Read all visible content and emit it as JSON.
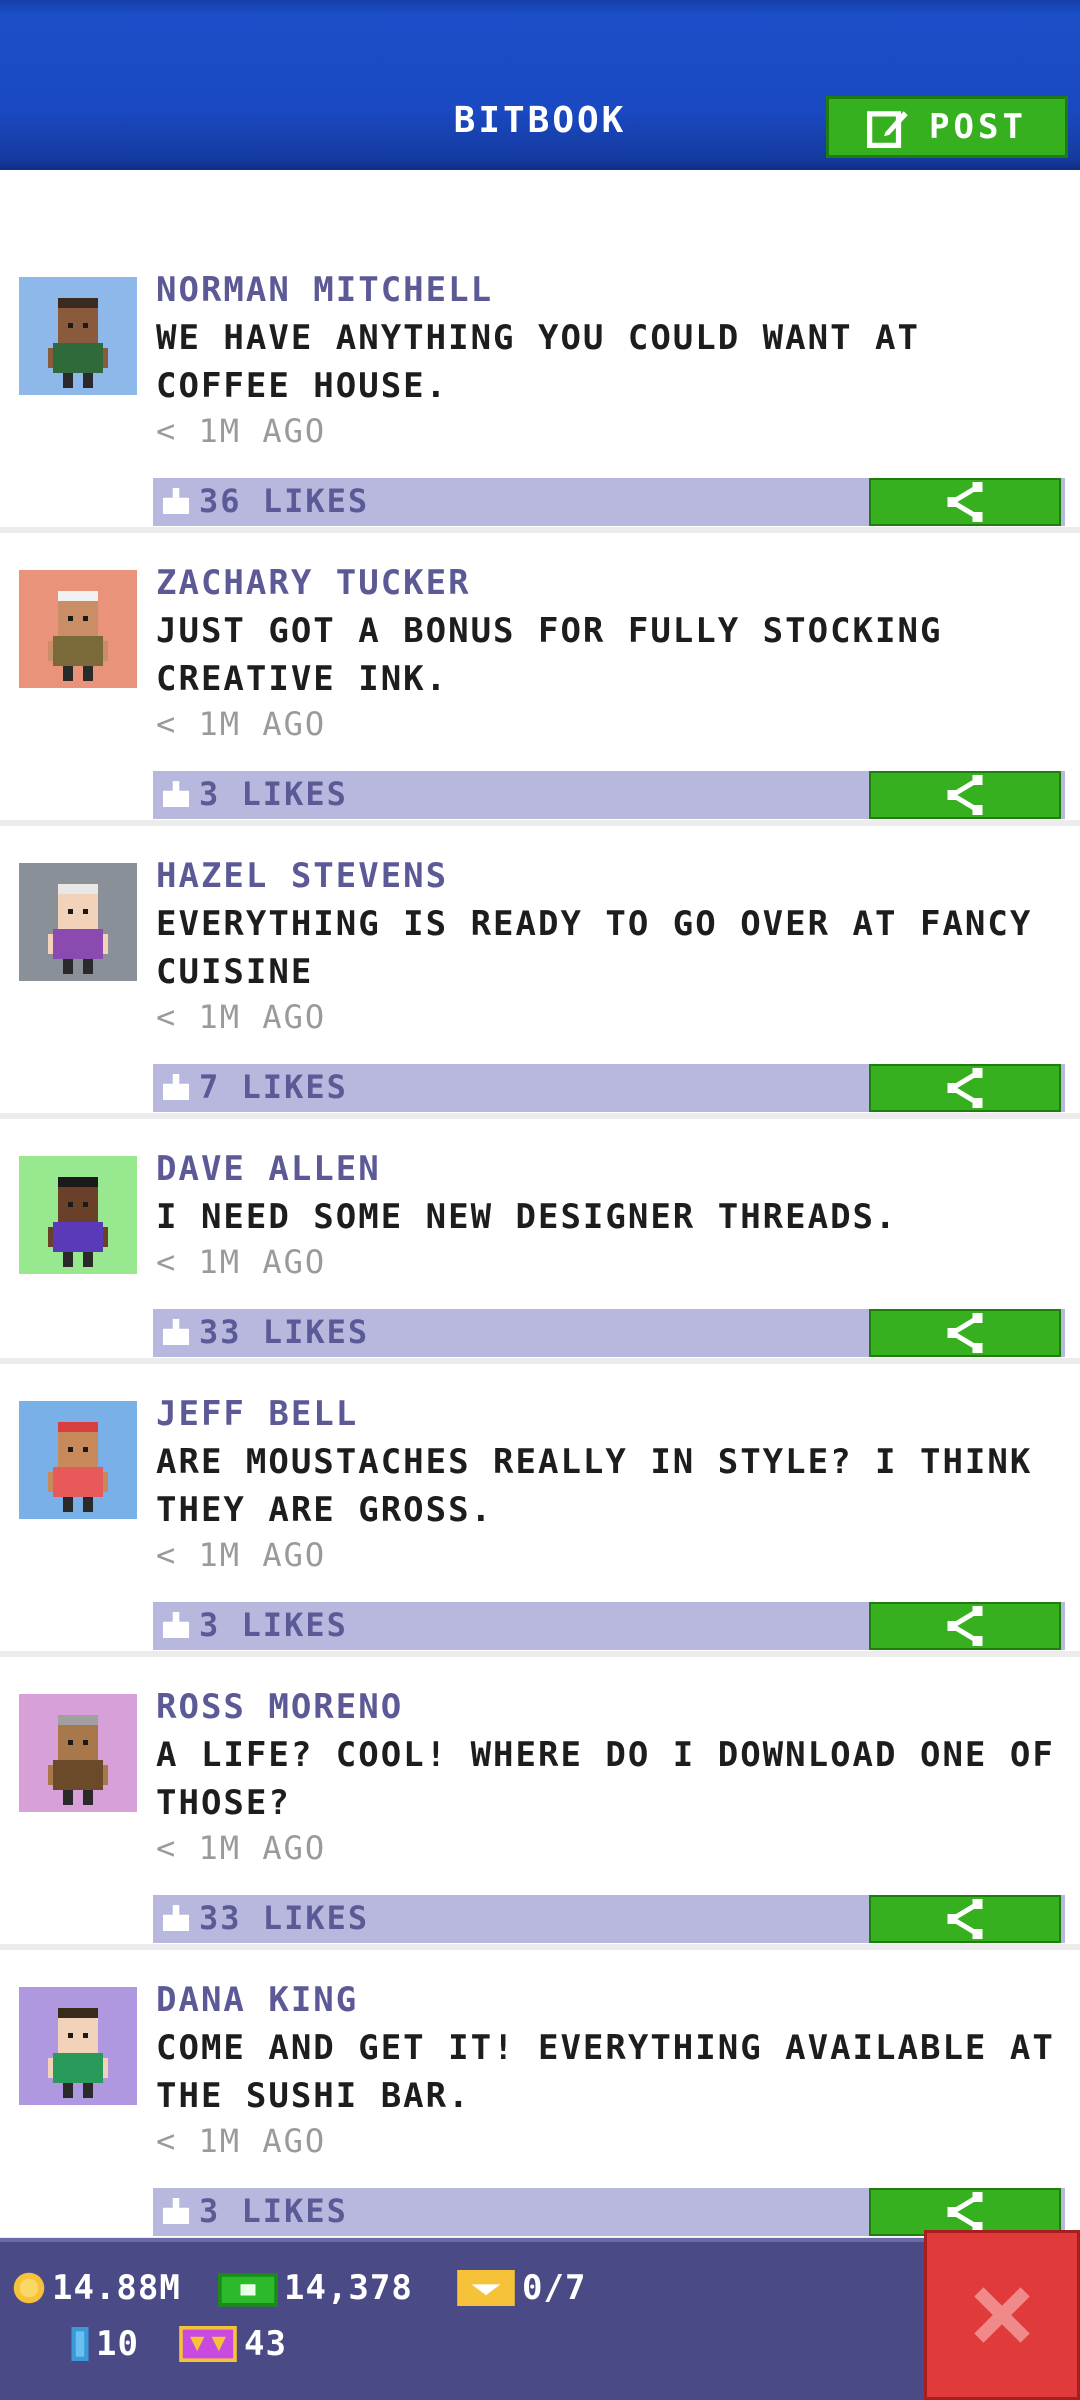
{
  "header": {
    "title": "BITBOOK",
    "post_label": "POST"
  },
  "posts": [
    {
      "author": "NORMAN MITCHELL",
      "message": "WE HAVE ANYTHING YOU COULD WANT AT COFFEE HOUSE.",
      "time": "< 1M AGO",
      "likes": "36 LIKES",
      "avatar_bg": "#8fb8ea",
      "skin": "#8a5a3c",
      "hair": "#3a2a20",
      "shirt": "#2f6b3a"
    },
    {
      "author": "ZACHARY TUCKER",
      "message": "JUST GOT A BONUS FOR FULLY STOCKING CREATIVE INK.",
      "time": "< 1M AGO",
      "likes": "3 LIKES",
      "avatar_bg": "#e8937a",
      "skin": "#c98e66",
      "hair": "#f0f0f0",
      "shirt": "#7a6a3a"
    },
    {
      "author": "HAZEL STEVENS",
      "message": "EVERYTHING IS READY TO GO OVER AT FANCY CUISINE",
      "time": "< 1M AGO",
      "likes": "7 LIKES",
      "avatar_bg": "#8a9098",
      "skin": "#f2d2b8",
      "hair": "#e8e8e8",
      "shirt": "#8a4ab0"
    },
    {
      "author": "DAVE ALLEN",
      "message": "I NEED SOME NEW DESIGNER THREADS.",
      "time": "< 1M AGO",
      "likes": "33 LIKES",
      "avatar_bg": "#98e890",
      "skin": "#6a4028",
      "hair": "#1a1a1a",
      "shirt": "#5a3ab8"
    },
    {
      "author": "JEFF BELL",
      "message": "ARE MOUSTACHES REALLY IN STYLE? I THINK THEY ARE GROSS.",
      "time": "< 1M AGO",
      "likes": "3 LIKES",
      "avatar_bg": "#7ab0e8",
      "skin": "#c88a5a",
      "hair": "#d84040",
      "shirt": "#e85a5a"
    },
    {
      "author": "ROSS MORENO",
      "message": "A LIFE? COOL! WHERE DO I DOWNLOAD ONE OF THOSE?",
      "time": "< 1M AGO",
      "likes": "33 LIKES",
      "avatar_bg": "#d8a0d8",
      "skin": "#a8784a",
      "hair": "#a0a0a0",
      "shirt": "#6a4a28"
    },
    {
      "author": "DANA KING",
      "message": "COME AND GET IT! EVERYTHING AVAILABLE AT THE SUSHI BAR.",
      "time": "< 1M AGO",
      "likes": "3 LIKES",
      "avatar_bg": "#b098e0",
      "skin": "#f2d2b8",
      "hair": "#3a2a1a",
      "shirt": "#2a9a5a"
    }
  ],
  "bottom_bar": {
    "coins": "14.88M",
    "bux": "14,378",
    "tickets": "0/7",
    "level": "10",
    "gems": "43"
  },
  "colors": {
    "accent_green": "#36b01f",
    "header_blue": "#1b4ec8",
    "likes_bar": "#b8b8de",
    "author_purple": "#5c5a96",
    "close_red": "#e03a3a"
  }
}
